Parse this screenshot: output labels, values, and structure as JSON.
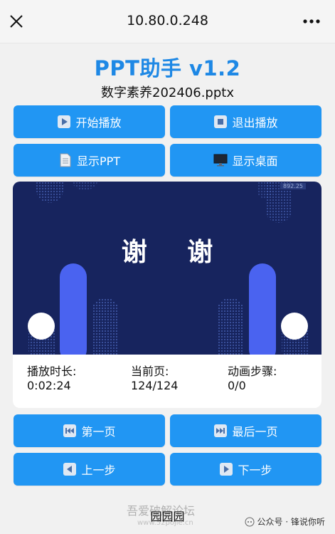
{
  "browser": {
    "host": "10.80.0.248",
    "close_icon": "close-icon",
    "more_icon": "more-dots-icon"
  },
  "app": {
    "title": "PPT助手 v1.2",
    "filename": "数字素养202406.pptx"
  },
  "controls": {
    "start": "开始播放",
    "exit": "退出播放",
    "show_ppt": "显示PPT",
    "show_desktop": "显示桌面"
  },
  "slide": {
    "text": "谢 谢",
    "tag": "892.25",
    "page_dots": 5,
    "active_dot": 2
  },
  "stats": {
    "duration_label": "播放时长:",
    "duration_value": "0:02:24",
    "page_label": "当前页:",
    "page_value": "124/124",
    "anim_label": "动画步骤:",
    "anim_value": "0/0"
  },
  "nav": {
    "first": "第一页",
    "last": "最后一页",
    "prev": "上一步",
    "next": "下一步"
  },
  "footer": {
    "text": "园园园",
    "watermark": "吾爱破解论坛",
    "watermark_url": "www.52pojie.cn",
    "wechat": "公众号 · 锋说你听"
  },
  "colors": {
    "accent": "#2196f3",
    "title": "#1e88e5",
    "slide_bg": "#17245e"
  }
}
